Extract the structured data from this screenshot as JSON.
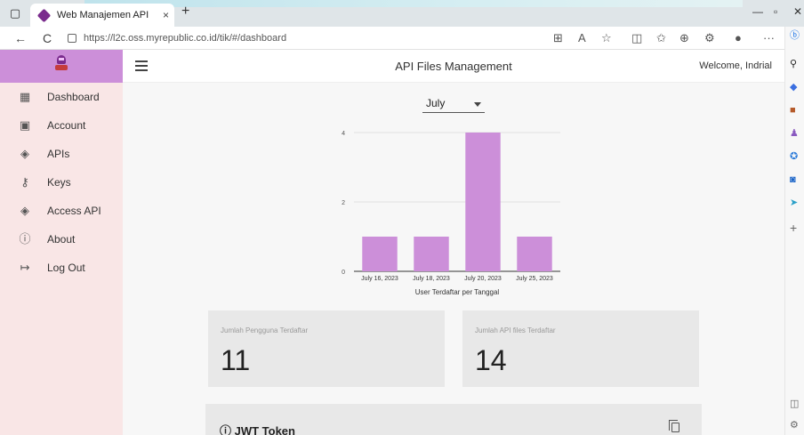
{
  "browser": {
    "tab_title": "Web Manajemen API",
    "tab_close": "×",
    "new_tab": "+",
    "url": "https://l2c.oss.myrepublic.co.id/tik/#/dashboard",
    "back_icon": "←",
    "reload_icon": "C",
    "more": "···"
  },
  "app": {
    "title": "API Files Management",
    "welcome": "Welcome, Indrial"
  },
  "sidebar": {
    "items": [
      {
        "label": "Dashboard",
        "icon": "▦"
      },
      {
        "label": "Account",
        "icon": "▣"
      },
      {
        "label": "APIs",
        "icon": "◈"
      },
      {
        "label": "Keys",
        "icon": "⚷"
      },
      {
        "label": "Access API",
        "icon": "◈"
      },
      {
        "label": "About",
        "icon": "ⓘ"
      },
      {
        "label": "Log Out",
        "icon": "↦"
      }
    ]
  },
  "filter": {
    "month": "July"
  },
  "chart_data": {
    "type": "bar",
    "categories": [
      "July 16, 2023",
      "July 18, 2023",
      "July 20, 2023",
      "July 25, 2023"
    ],
    "values": [
      1,
      1,
      4,
      1
    ],
    "xlabel": "User Terdaftar per Tanggal",
    "ylabel": "",
    "ylim": [
      0,
      4
    ],
    "yticks": [
      0,
      2,
      4
    ],
    "bar_color": "#cc8fd9",
    "grid": true
  },
  "stats": {
    "users_label": "Jumlah Pengguna Terdaftar",
    "users_value": "11",
    "apis_label": "Jumlah API files Terdaftar",
    "apis_value": "14"
  },
  "jwt": {
    "title": "ⓘ JWT Token"
  },
  "colors": {
    "accent": "#cc8fd9",
    "sidebar_bg": "#f9e6e6",
    "card_bg": "#e8e8e8"
  }
}
